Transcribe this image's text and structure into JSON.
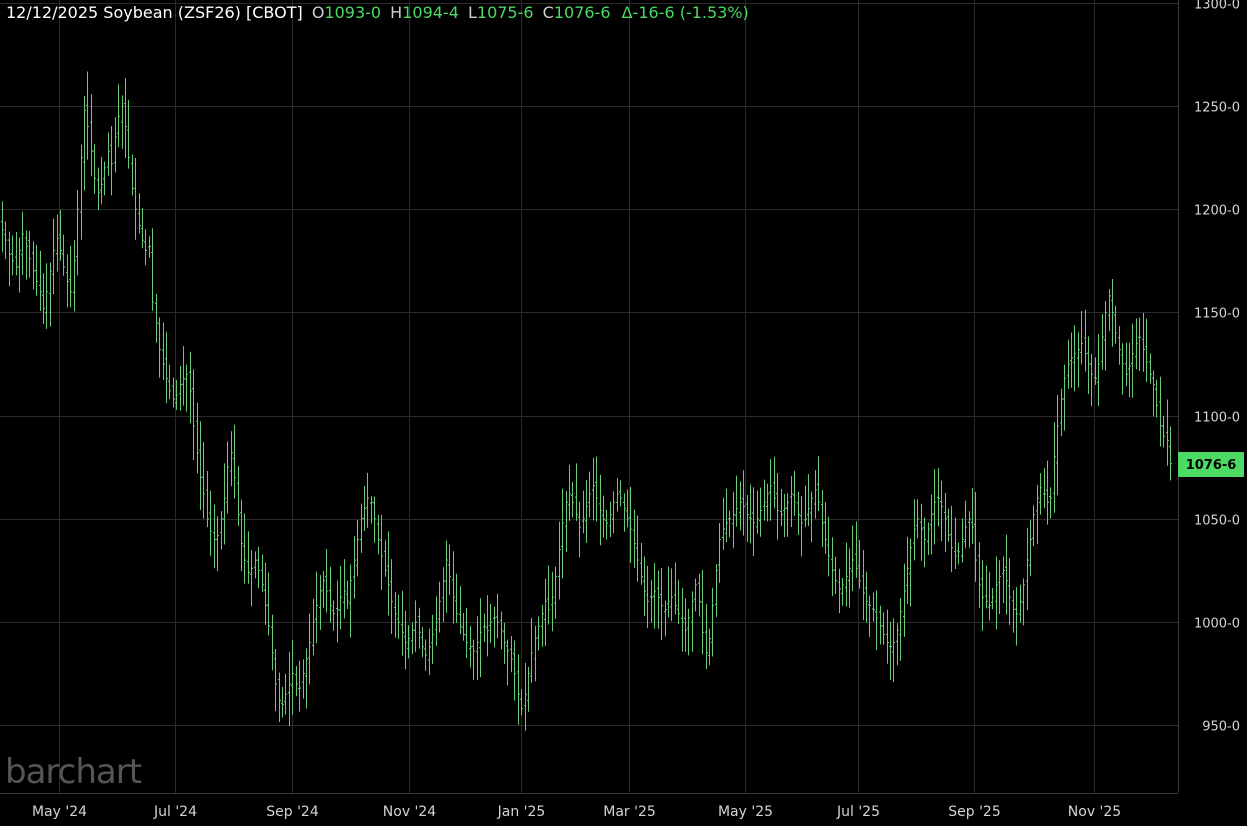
{
  "header": {
    "symbol_line": "12/12/2025 Soybean (ZSF26) [CBOT]",
    "open_label": "O",
    "open_value": "1093-0",
    "high_label": "H",
    "high_value": "1094-4",
    "low_label": "L",
    "low_value": "1075-6",
    "close_label": "C",
    "close_value": "1076-6",
    "change": "Δ-16-6 (-1.53%)"
  },
  "watermark": "barchart",
  "last_price_label": "1076-6",
  "colors": {
    "background": "#000000",
    "bars": "#66cc77",
    "accent": "#4cd964",
    "grid": "#2b2b2b",
    "text": "#d4d4d4"
  },
  "chart_data": {
    "type": "ohlc",
    "ylim": [
      940,
      1300
    ],
    "yticks": [
      {
        "value": 1300,
        "label": "1300-0"
      },
      {
        "value": 1250,
        "label": "1250-0"
      },
      {
        "value": 1200,
        "label": "1200-0"
      },
      {
        "value": 1150,
        "label": "1150-0"
      },
      {
        "value": 1100,
        "label": "1100-0"
      },
      {
        "value": 1050,
        "label": "1050-0"
      },
      {
        "value": 1000,
        "label": "1000-0"
      },
      {
        "value": 950,
        "label": "950-0"
      }
    ],
    "xticks": [
      "May '24",
      "Jul '24",
      "Sep '24",
      "Nov '24",
      "Jan '25",
      "Mar '25",
      "May '25",
      "Jul '25",
      "Sep '25",
      "Nov '25"
    ],
    "last_close": 1076.75,
    "closes": [
      1190,
      1185,
      1178,
      1175,
      1172,
      1180,
      1188,
      1182,
      1176,
      1170,
      1165,
      1160,
      1152,
      1160,
      1170,
      1180,
      1186,
      1180,
      1172,
      1165,
      1160,
      1175,
      1200,
      1225,
      1248,
      1240,
      1228,
      1215,
      1208,
      1212,
      1220,
      1228,
      1222,
      1235,
      1245,
      1250,
      1240,
      1225,
      1210,
      1200,
      1192,
      1185,
      1180,
      1182,
      1155,
      1145,
      1132,
      1125,
      1118,
      1112,
      1108,
      1110,
      1115,
      1118,
      1120,
      1112,
      1095,
      1082,
      1070,
      1062,
      1050,
      1044,
      1040,
      1042,
      1050,
      1060,
      1075,
      1082,
      1070,
      1052,
      1038,
      1030,
      1024,
      1026,
      1030,
      1025,
      1018,
      1008,
      998,
      985,
      970,
      962,
      960,
      965,
      970,
      975,
      970,
      968,
      975,
      982,
      990,
      1000,
      1008,
      1015,
      1020,
      1015,
      1008,
      1004,
      1006,
      1012,
      1015,
      1010,
      1020,
      1030,
      1040,
      1050,
      1055,
      1060,
      1058,
      1050,
      1040,
      1032,
      1025,
      1018,
      1010,
      1004,
      1000,
      995,
      990,
      992,
      996,
      1000,
      995,
      988,
      984,
      988,
      994,
      1000,
      1010,
      1020,
      1030,
      1022,
      1012,
      1004,
      998,
      994,
      990,
      988,
      986,
      990,
      995,
      998,
      996,
      1000,
      1002,
      1000,
      996,
      990,
      986,
      982,
      975,
      965,
      958,
      965,
      975,
      985,
      992,
      998,
      1004,
      1010,
      1006,
      1012,
      1022,
      1035,
      1048,
      1058,
      1062,
      1058,
      1052,
      1046,
      1050,
      1056,
      1062,
      1066,
      1060,
      1054,
      1050,
      1048,
      1052,
      1058,
      1062,
      1060,
      1055,
      1050,
      1045,
      1038,
      1030,
      1022,
      1015,
      1010,
      1012,
      1015,
      1012,
      1008,
      1006,
      1010,
      1012,
      1008,
      1004,
      1000,
      996,
      1002,
      1010,
      1018,
      1010,
      995,
      985,
      992,
      1008,
      1025,
      1040,
      1045,
      1048,
      1050,
      1052,
      1055,
      1058,
      1056,
      1052,
      1050,
      1048,
      1050,
      1054,
      1058,
      1062,
      1066,
      1060,
      1054,
      1052,
      1055,
      1058,
      1062,
      1058,
      1052,
      1048,
      1050,
      1055,
      1060,
      1064,
      1058,
      1048,
      1040,
      1032,
      1025,
      1020,
      1016,
      1018,
      1022,
      1026,
      1030,
      1026,
      1020,
      1014,
      1010,
      1008,
      1006,
      1002,
      998,
      994,
      990,
      988,
      990,
      996,
      1005,
      1015,
      1026,
      1036,
      1045,
      1050,
      1045,
      1040,
      1045,
      1052,
      1058,
      1060,
      1056,
      1050,
      1042,
      1036,
      1032,
      1034,
      1040,
      1046,
      1050,
      1046,
      1030,
      1018,
      1012,
      1010,
      1008,
      1012,
      1018,
      1022,
      1025,
      1020,
      1012,
      1006,
      1004,
      1010,
      1018,
      1030,
      1040,
      1052,
      1060,
      1065,
      1062,
      1058,
      1060,
      1080,
      1095,
      1108,
      1118,
      1125,
      1128,
      1130,
      1132,
      1135,
      1130,
      1125,
      1120,
      1118,
      1125,
      1138,
      1150,
      1158,
      1150,
      1140,
      1132,
      1125,
      1120,
      1124,
      1130,
      1135,
      1138,
      1132,
      1126,
      1120,
      1115,
      1105,
      1095,
      1090,
      1088,
      1076.75
    ]
  }
}
